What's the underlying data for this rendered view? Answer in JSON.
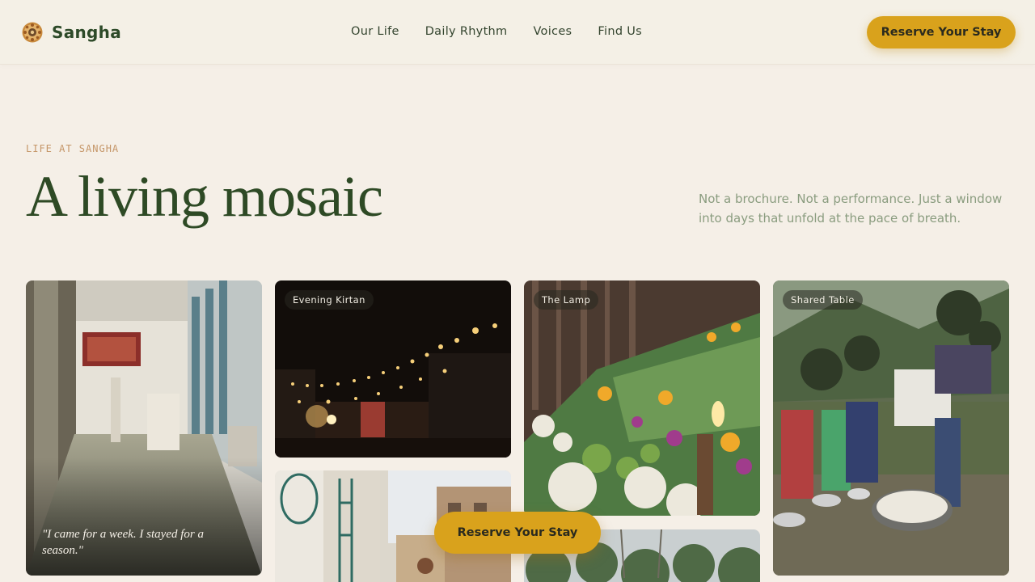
{
  "brand": {
    "name": "Sangha",
    "logo_icon": "mandala-icon"
  },
  "nav": {
    "items": [
      "Our Life",
      "Daily Rhythm",
      "Voices",
      "Find Us"
    ]
  },
  "header": {
    "cta_label": "Reserve Your Stay"
  },
  "hero": {
    "eyebrow": "LIFE AT SANGHA",
    "title": "A living mosaic",
    "subtitle": "Not a brochure. Not a performance. Just a window into days that unfold at the pace of breath."
  },
  "mosaic": {
    "tiles": [
      {
        "caption": "",
        "quote": "\"I came for a week. I stayed for a season.\""
      },
      {
        "caption": "Evening Kirtan"
      },
      {
        "caption": "The Lamp"
      },
      {
        "caption": "Shared Table"
      },
      {
        "caption": ""
      },
      {
        "caption": ""
      }
    ]
  },
  "floating_cta": {
    "label": "Reserve Your Stay"
  },
  "colors": {
    "background": "#f5efe7",
    "accent": "#d9a21c",
    "heading": "#2e4a25",
    "eyebrow": "#c59668",
    "muted": "#8a9c7f"
  }
}
